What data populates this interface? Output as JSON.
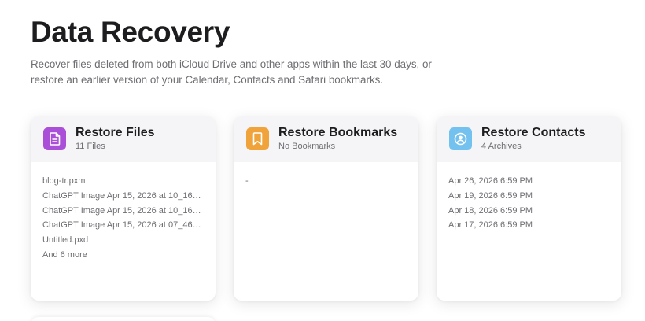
{
  "header": {
    "title": "Data Recovery",
    "description": "Recover files deleted from both iCloud Drive and other apps within the last 30 days, or restore an earlier version of your Calendar, Contacts and Safari bookmarks."
  },
  "cards": [
    {
      "title": "Restore Files",
      "subtitle": "11 Files",
      "icon": "document-icon",
      "icon_color": "#a94fd8",
      "items": [
        "blog-tr.pxm",
        "ChatGPT Image Apr 15, 2026 at 10_16_2...",
        "ChatGPT Image Apr 15, 2026 at 10_16_2...",
        "ChatGPT Image Apr 15, 2026 at 07_46_0...",
        "Untitled.pxd",
        "And 6 more"
      ]
    },
    {
      "title": "Restore Bookmarks",
      "subtitle": "No Bookmarks",
      "icon": "bookmark-icon",
      "icon_color": "#f1a33b",
      "items": [
        "-"
      ]
    },
    {
      "title": "Restore Contacts",
      "subtitle": "4 Archives",
      "icon": "contact-icon",
      "icon_color": "#72c1ee",
      "items": [
        "Apr 26, 2026 6:59 PM",
        "Apr 19, 2026 6:59 PM",
        "Apr 18, 2026 6:59 PM",
        "Apr 17, 2026 6:59 PM"
      ]
    }
  ]
}
